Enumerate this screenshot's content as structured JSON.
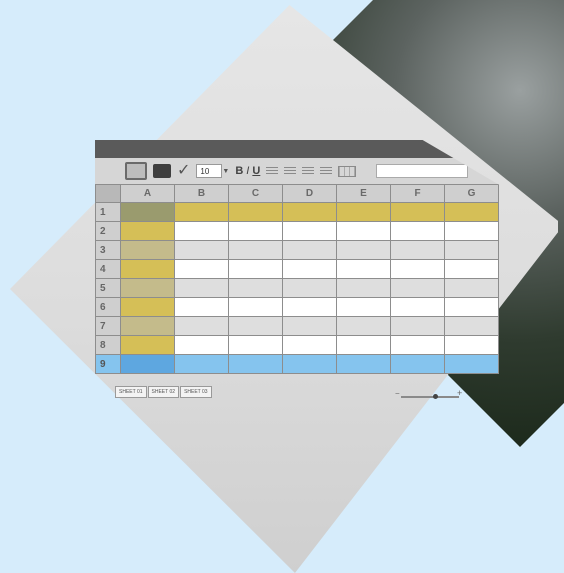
{
  "toolbar": {
    "font_size": "10",
    "bold": "B",
    "italic": "I",
    "underline": "U"
  },
  "columns": [
    "A",
    "B",
    "C",
    "D",
    "E",
    "F",
    "G"
  ],
  "rows": [
    "1",
    "2",
    "3",
    "4",
    "5",
    "6",
    "7",
    "8",
    "9"
  ],
  "tabs": [
    "SHEET 01",
    "SHEET 02",
    "SHEET 03"
  ],
  "zoom": {
    "minus": "−",
    "plus": "+"
  },
  "colors": {
    "gold": "#d5bf57",
    "olive": "#9a9b6e",
    "khaki": "#c4bb8b",
    "blue": "#85c4ee",
    "blue_dark": "#5ea7e0",
    "white": "#ffffff",
    "light": "#dedede"
  }
}
